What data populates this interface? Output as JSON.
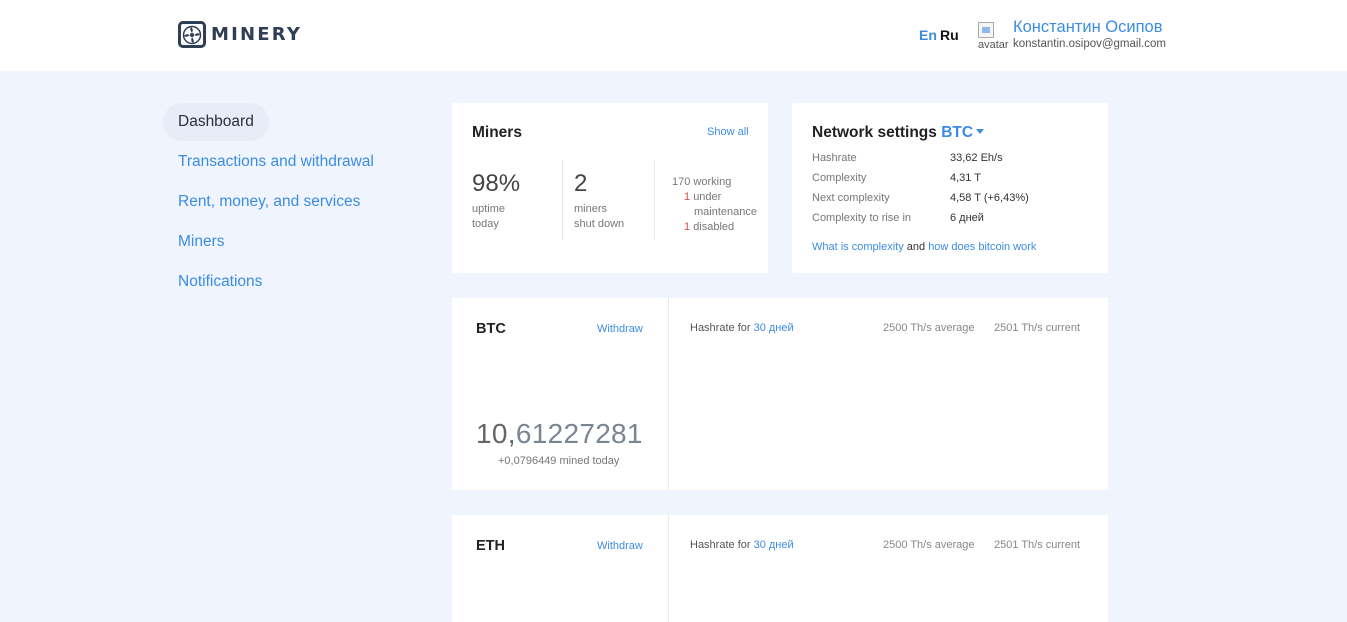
{
  "header": {
    "logo_text": "MINERY",
    "lang_en": "En",
    "lang_ru": "Ru",
    "avatar_alt": "avatar",
    "user_name": "Константин Осипов",
    "user_email": "konstantin.osipov@gmail.com"
  },
  "nav": {
    "items": [
      {
        "label": "Dashboard",
        "active": true
      },
      {
        "label": "Transactions and withdrawal"
      },
      {
        "label": "Rent, money, and services"
      },
      {
        "label": "Miners"
      },
      {
        "label": "Notifications"
      }
    ]
  },
  "miners": {
    "title": "Miners",
    "show_all": "Show all",
    "uptime_value": "98%",
    "uptime_label_1": "uptime",
    "uptime_label_2": "today",
    "shutdown_value": "2",
    "shutdown_label_1": "miners",
    "shutdown_label_2": "shut down",
    "working_count": "170",
    "working_label": "working",
    "maintenance_count": "1",
    "maintenance_label_1": "under",
    "maintenance_label_2": "maintenance",
    "disabled_count": "1",
    "disabled_label": "disabled"
  },
  "network": {
    "title": "Network settings",
    "coin": "BTC",
    "rows": [
      {
        "label": "Hashrate",
        "value": "33,62 Eh/s"
      },
      {
        "label": "Complexity",
        "value": "4,31 T"
      },
      {
        "label": "Next complexity",
        "value": "4,58 T (+6,43%)"
      },
      {
        "label": "Complexity to rise in",
        "value": "6 дней"
      }
    ],
    "link_complexity": "What is complexity",
    "link_and": "and",
    "link_bitcoin": "how does bitcoin work"
  },
  "btc": {
    "name": "BTC",
    "withdraw": "Withdraw",
    "balance_int": "10,",
    "balance_dec": "61227281",
    "mined_today": "+0,0796449 mined today",
    "hashrate_for": "Hashrate for",
    "period": "30 дней",
    "average": "2500 Th/s average",
    "current": "2501 Th/s current"
  },
  "eth": {
    "name": "ETH",
    "withdraw": "Withdraw",
    "hashrate_for": "Hashrate for",
    "period": "30 дней",
    "average": "2500 Th/s average",
    "current": "2501 Th/s current"
  }
}
